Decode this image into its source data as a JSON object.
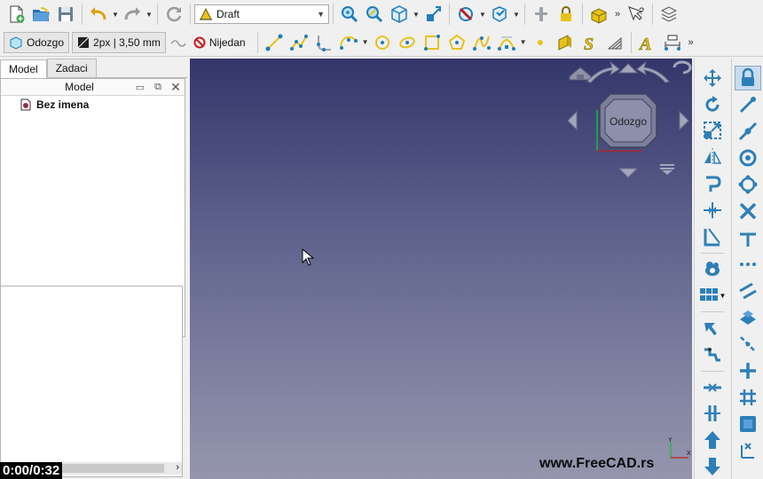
{
  "toolbar1": {
    "workbench_label": "Draft",
    "icons": [
      "new-document-icon",
      "open-folder-icon",
      "save-icon",
      "undo-icon",
      "redo-icon",
      "refresh-icon",
      "fit-all-icon",
      "fit-selection-icon",
      "isometric-view-icon",
      "measure-icon",
      "no-draw-style-icon",
      "bounding-box-icon",
      "pick-tool-icon",
      "lock-icon",
      "part-icon",
      "more-icon",
      "whats-this-icon",
      "workbench-stack-icon"
    ]
  },
  "toolbar2": {
    "view_label": "Odozgo",
    "line_style_label": "2px | 3,50 mm",
    "construction_label": "Nijedan",
    "icons": [
      "line-icon",
      "wire-icon",
      "fillet-icon",
      "arc-icon",
      "circle-icon",
      "ellipse-icon",
      "rectangle-icon",
      "polygon-icon",
      "bspline-icon",
      "bezier-icon",
      "point-icon",
      "facebinder-icon",
      "shapestring-icon",
      "hatch-icon",
      "text-icon",
      "dimension-icon"
    ]
  },
  "left_panel": {
    "tabs": [
      "Model",
      "Zadaci"
    ],
    "tree_header": "Model",
    "tree_items": [
      "Bez imena"
    ]
  },
  "viewport": {
    "navcube_face": "Odozgo",
    "watermark": "www.FreeCAD.rs",
    "axis_y": "Y",
    "axis_x": "X"
  },
  "video": {
    "timecode": "0:00/0:32"
  },
  "right_toolbar_1": {
    "icons": [
      "move-icon",
      "rotate-icon",
      "scale-icon",
      "mirror-icon",
      "offset-icon",
      "stretch-icon",
      "trimex-icon",
      "clone-icon",
      "array-icon",
      "join-icon",
      "split-icon",
      "upgrade-icon",
      "downgrade-icon"
    ]
  },
  "right_toolbar_2": {
    "icons": [
      "snap-lock-icon",
      "snap-endpoint-icon",
      "snap-midpoint-icon",
      "snap-center-icon",
      "snap-angle-icon",
      "snap-intersection-icon",
      "snap-perpendicular-icon",
      "snap-extension-icon",
      "snap-parallel-icon",
      "snap-special-icon",
      "snap-near-icon",
      "snap-ortho-icon",
      "snap-grid-icon",
      "snap-workingplane-icon",
      "snap-dimensions-icon"
    ]
  },
  "colors": {
    "icon_blue": "#2d7fb8",
    "icon_yellow": "#e8c21a",
    "viewport_top": "#33366a",
    "viewport_bottom": "#9596ad"
  }
}
